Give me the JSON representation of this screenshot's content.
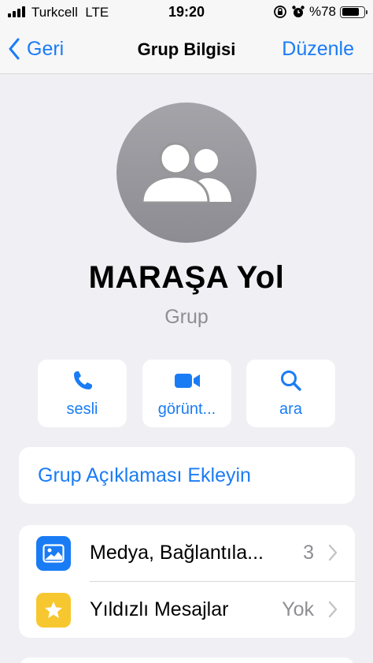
{
  "status_bar": {
    "carrier": "Turkcell",
    "network": "LTE",
    "time": "19:20",
    "battery_text": "%78",
    "battery_level": 0.78
  },
  "nav": {
    "back_label": "Geri",
    "title": "Grup Bilgisi",
    "edit_label": "Düzenle"
  },
  "profile": {
    "name": "MARAŞA Yol",
    "subtitle": "Grup"
  },
  "actions": [
    {
      "label": "sesli",
      "icon": "phone-icon"
    },
    {
      "label": "görünt...",
      "icon": "video-icon"
    },
    {
      "label": "ara",
      "icon": "search-icon"
    }
  ],
  "description": {
    "label": "Grup Açıklaması Ekleyin"
  },
  "list": [
    {
      "title": "Medya, Bağlantıla...",
      "value": "3",
      "icon": "photo-icon",
      "color": "#1a7cf5"
    },
    {
      "title": "Yıldızlı Mesajlar",
      "value": "Yok",
      "icon": "star-icon",
      "color": "#f7c72f"
    }
  ],
  "colors": {
    "accent": "#1a7cf5",
    "background": "#efeff4",
    "secondary_text": "#8e8e93"
  }
}
